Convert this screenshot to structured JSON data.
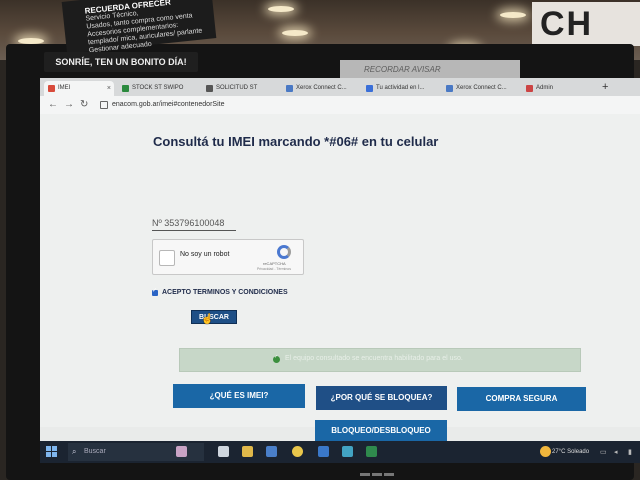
{
  "photo": {
    "sticky_note": {
      "heading": "RECUERDA OFRECER",
      "lines": [
        "Servicio Técnico,",
        "Usados, tanto compra como venta",
        "Accesorios complementarios:",
        "templado/ mica, auriculares/ parlante",
        "Gestionar adecuado"
      ]
    },
    "bezel_label": "SONRÍE, TEN UN BONITO DÍA!",
    "tape_text": "RECORDAR AVISAR",
    "store_sign": "CH"
  },
  "browser": {
    "tabs": [
      {
        "label": "IMEI",
        "active": true
      },
      {
        "label": "STOCK ST SWIPO",
        "active": false
      },
      {
        "label": "SOLICITUD ST",
        "active": false
      },
      {
        "label": "Xerox Connect C...",
        "active": false
      },
      {
        "label": "Tu actividad en l...",
        "active": false
      },
      {
        "label": "Xerox Connect C...",
        "active": false
      },
      {
        "label": "Admin",
        "active": false
      }
    ],
    "new_tab_label": "+",
    "url": "enacom.gob.ar/imei#contenedorSite"
  },
  "page": {
    "title": "Consultá tu IMEI marcando *#06# en tu celular",
    "imei_value": "Nº 353796100048",
    "recaptcha": {
      "label": "No soy un robot",
      "brand": "reCAPTCHA",
      "terms": "Privacidad - Términos"
    },
    "terms_label": "ACEPTO TERMINOS Y CONDICIONES",
    "terms_checked": true,
    "search_button": "BUSCAR",
    "result_message": "El equipo consultado se encuentra habilitado para el uso.",
    "result_color": "#c7d7c8",
    "buttons": {
      "que_es_imei": "¿QUÉ ES IMEI?",
      "por_que_bloquea": "¿POR QUÉ SE BLOQUEA?",
      "compra_segura": "COMPRA SEGURA",
      "bloqueo": "BLOQUEO/DESBLOQUEO"
    },
    "accent": "#1a67a6"
  },
  "taskbar": {
    "search_placeholder": "Buscar",
    "weather": "27°C  Soleado"
  }
}
